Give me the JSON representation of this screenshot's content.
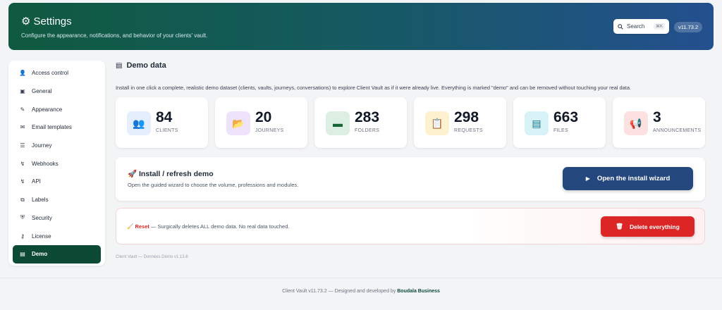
{
  "header": {
    "title": "Settings",
    "subtitle": "Configure the appearance, notifications, and behavior of your clients' vault.",
    "search_label": "Search",
    "search_shortcut": "⌘K",
    "version": "v11.73.2"
  },
  "sidebar": {
    "items": [
      {
        "label": "Access control",
        "icon": "user-icon"
      },
      {
        "label": "General",
        "icon": "general-icon"
      },
      {
        "label": "Appearance",
        "icon": "brush-icon"
      },
      {
        "label": "Email templates",
        "icon": "envelope-icon"
      },
      {
        "label": "Journey",
        "icon": "journey-icon"
      },
      {
        "label": "Webhooks",
        "icon": "webhook-icon"
      },
      {
        "label": "API",
        "icon": "api-icon"
      },
      {
        "label": "Labels",
        "icon": "tag-icon"
      },
      {
        "label": "Security",
        "icon": "shield-icon"
      },
      {
        "label": "License",
        "icon": "key-icon"
      },
      {
        "label": "Demo",
        "icon": "demo-icon",
        "active": true
      }
    ]
  },
  "main": {
    "title": "Demo data",
    "intro": "Install in one click a complete, realistic demo dataset (clients, vaults, journeys, conversations) to explore Client Vault as if it were already live. Everything is marked \"demo\" and can be removed without touching your real data.",
    "stats": [
      {
        "value": "84",
        "label": "CLIENTS",
        "icon": "users-icon",
        "bg": "#e5eefc",
        "fg": "#2563eb"
      },
      {
        "value": "20",
        "label": "JOURNEYS",
        "icon": "folder-open-icon",
        "bg": "#efe3fb",
        "fg": "#7e22ce"
      },
      {
        "value": "283",
        "label": "FOLDERS",
        "icon": "folder-icon",
        "bg": "#dcefe2",
        "fg": "#166534"
      },
      {
        "value": "298",
        "label": "REQUESTS",
        "icon": "clipboard-icon",
        "bg": "#fdf1cf",
        "fg": "#a16207"
      },
      {
        "value": "663",
        "label": "FILES",
        "icon": "file-icon",
        "bg": "#d7f3f7",
        "fg": "#0e7490"
      },
      {
        "value": "3",
        "label": "ANNOUNCEMENTS",
        "icon": "megaphone-icon",
        "bg": "#fde0e0",
        "fg": "#b91c1c"
      }
    ],
    "install": {
      "title": "🚀 Install / refresh demo",
      "description": "Open the guided wizard to choose the volume, professions and modules.",
      "button": "Open the install wizard"
    },
    "reset": {
      "name": "Reset",
      "description": " — Surgically deletes ALL demo data. No real data touched.",
      "button": "Delete everything"
    },
    "footnote": "Client Vault — Données Démo v1.13.6"
  },
  "footer": {
    "prefix": "Client Vault",
    "version_text": " v11.73.2 — Designed and developed by ",
    "brand": "Boudala Business"
  }
}
